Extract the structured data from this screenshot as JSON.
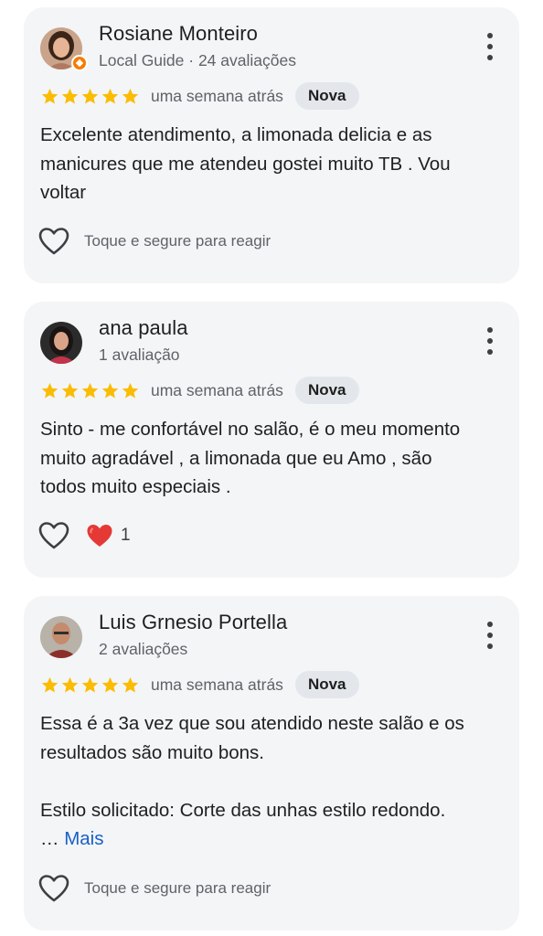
{
  "reviews": [
    {
      "author": "Rosiane Monteiro",
      "meta": "Local Guide · 24 avaliações",
      "is_local_guide": true,
      "rating": 5,
      "time": "uma semana atrás",
      "badge": "Nova",
      "text_lines": [
        "Excelente atendimento, a limonada delicia e as",
        "manicures que me atendeu gostei muito TB . Vou",
        "voltar"
      ],
      "react_hint": "Toque e segure para reagir"
    },
    {
      "author": "ana paula",
      "meta": "1 avaliação",
      "is_local_guide": false,
      "rating": 5,
      "time": "uma semana atrás",
      "badge": "Nova",
      "text_lines": [
        "Sinto - me confortável no salão, é o meu momento",
        "muito agradável , a limonada que eu Amo , são",
        "todos muito especiais ."
      ],
      "reaction_count": "1"
    },
    {
      "author": "Luis Grnesio Portella",
      "meta": "2 avaliações",
      "is_local_guide": false,
      "rating": 5,
      "time": "uma semana atrás",
      "badge": "Nova",
      "text_lines": [
        "Essa é a 3a vez que sou atendido neste salão e os",
        "resultados são muito bons.",
        "",
        "Estilo solicitado: Corte das unhas estilo redondo."
      ],
      "ellipsis": "…",
      "more_label": "Mais",
      "react_hint": "Toque e segure para reagir"
    }
  ],
  "colors": {
    "card_bg": "#f3f5f7",
    "star": "#fbbc04",
    "link": "#1a5fc7",
    "badge_bg": "#e3e7eb",
    "heart": "#e53935"
  },
  "icons": {
    "star": "star-icon",
    "more": "more-vert-icon",
    "heart_outline": "heart-outline-icon",
    "heart_filled": "heart-filled-icon",
    "local_guide": "local-guide-badge-icon"
  }
}
